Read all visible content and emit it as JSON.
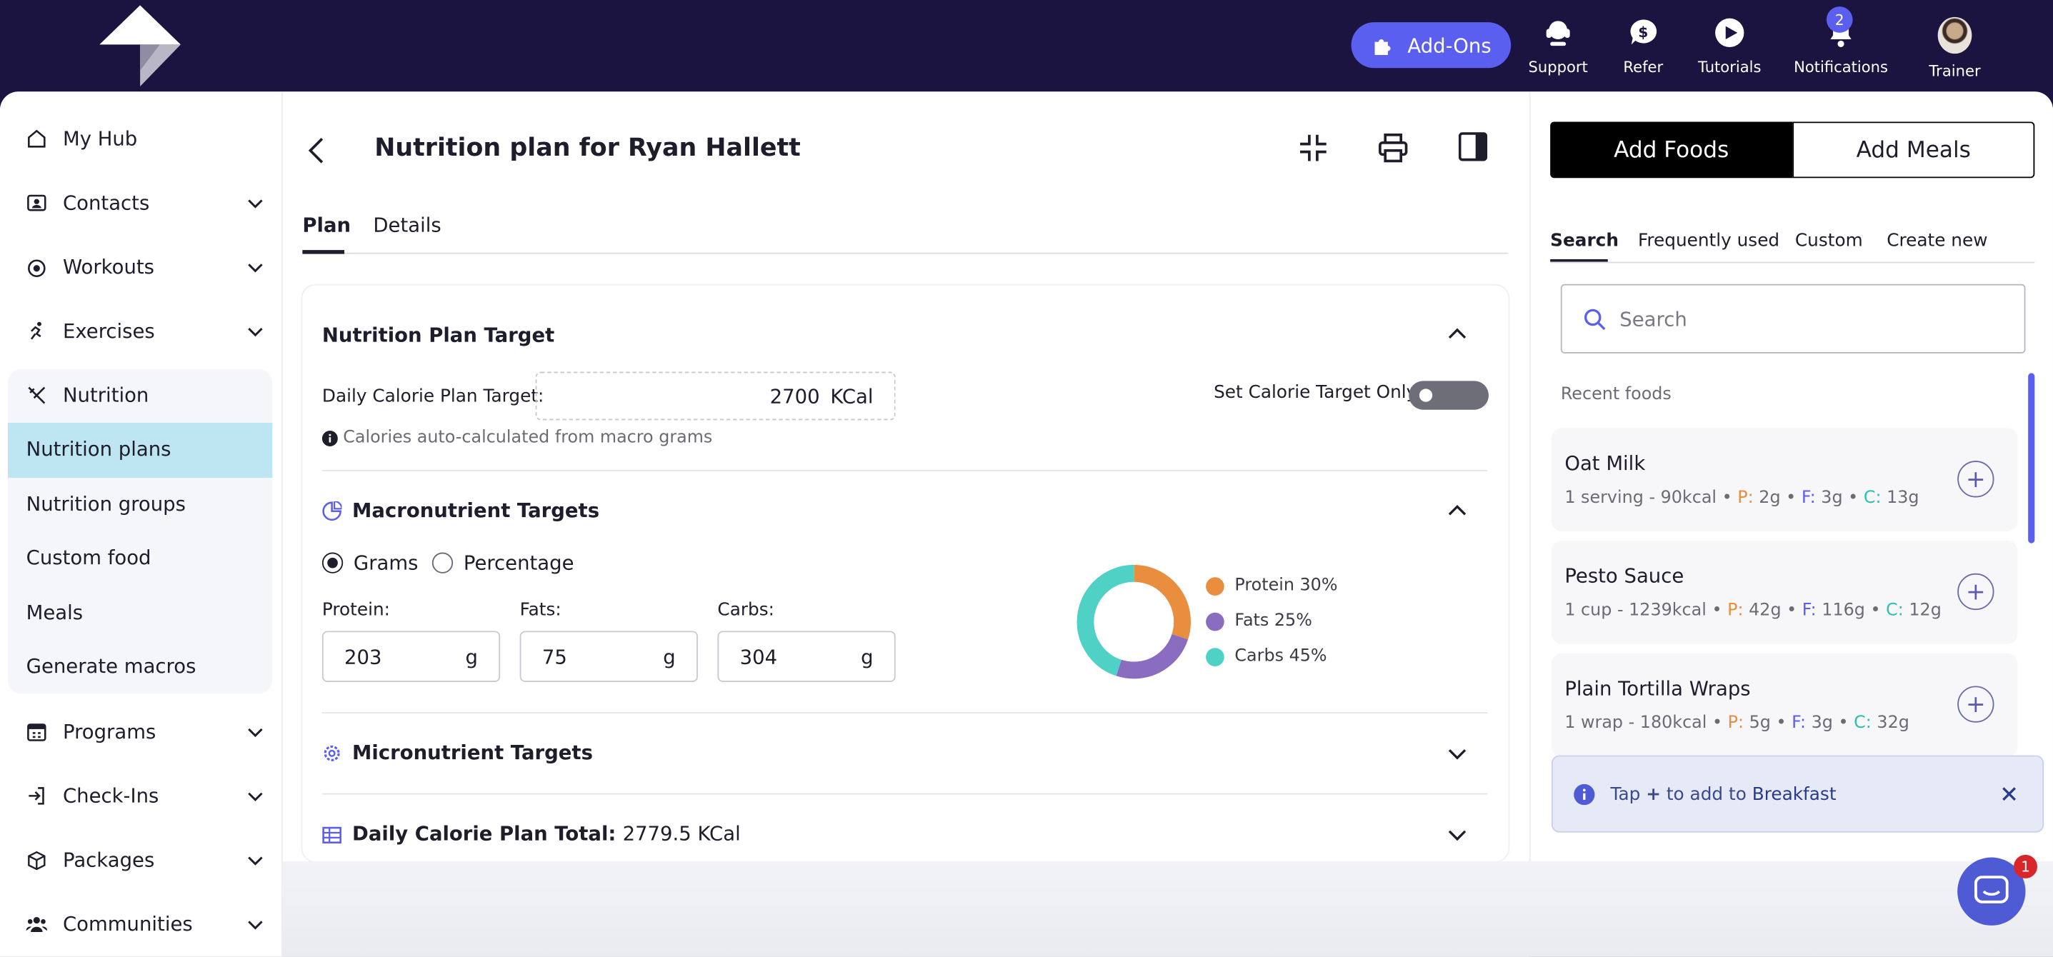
{
  "topbar": {
    "addons_label": "Add-Ons",
    "nav": [
      {
        "label": "Support",
        "icon": "headset-icon"
      },
      {
        "label": "Refer",
        "icon": "dollar-chat-icon"
      },
      {
        "label": "Tutorials",
        "icon": "play-icon"
      },
      {
        "label": "Notifications",
        "icon": "bell-icon",
        "badge": "2"
      },
      {
        "label": "Trainer",
        "icon": "avatar"
      }
    ]
  },
  "sidebar": {
    "items": [
      {
        "label": "My Hub",
        "icon": "home-icon"
      },
      {
        "label": "Contacts",
        "icon": "contacts-icon"
      },
      {
        "label": "Workouts",
        "icon": "workouts-icon"
      },
      {
        "label": "Exercises",
        "icon": "running-icon"
      },
      {
        "label": "Nutrition",
        "icon": "utensils-icon"
      },
      {
        "label": "Programs",
        "icon": "calendar-icon"
      },
      {
        "label": "Check-Ins",
        "icon": "check-in-icon"
      },
      {
        "label": "Packages",
        "icon": "package-icon"
      },
      {
        "label": "Communities",
        "icon": "users-icon"
      }
    ],
    "nutrition_sub": [
      "Nutrition plans",
      "Nutrition groups",
      "Custom food",
      "Meals",
      "Generate macros"
    ]
  },
  "plan": {
    "title": "Nutrition plan for Ryan Hallett",
    "tabs": [
      "Plan",
      "Details"
    ],
    "target_section": "Nutrition Plan Target",
    "daily_target_label": "Daily Calorie Plan Target:",
    "daily_target_value": "2700",
    "kcal_unit": "KCal",
    "calorie_only_label": "Set Calorie Target Only",
    "calorie_only_on": false,
    "auto_note": "Calories auto-calculated from macro grams",
    "macro_section": "Macronutrient Targets",
    "radio_grams": "Grams",
    "radio_percentage": "Percentage",
    "protein_label": "Protein:",
    "protein_value": "203",
    "fats_label": "Fats:",
    "fats_value": "75",
    "carbs_label": "Carbs:",
    "carbs_value": "304",
    "unit_g": "g",
    "micro_section": "Micronutrient Targets",
    "total_label": "Daily Calorie Plan Total:",
    "total_value": "2779.5 KCal"
  },
  "macros_chart": {
    "legend": [
      {
        "label": "Protein 30%",
        "value": 30,
        "color": "#e98e3e"
      },
      {
        "label": "Fats 25%",
        "value": 25,
        "color": "#8a6cc0"
      },
      {
        "label": "Carbs 45%",
        "value": 45,
        "color": "#4fd1c5"
      }
    ]
  },
  "panel": {
    "add_foods": "Add Foods",
    "add_meals": "Add Meals",
    "tabs": [
      "Search",
      "Frequently used",
      "Custom",
      "Create new"
    ],
    "search_placeholder": "Search",
    "recent_label": "Recent foods",
    "foods": [
      {
        "name": "Oat Milk",
        "serving": "1 serving - 90kcal",
        "p": "2g",
        "f": "3g",
        "c": "13g"
      },
      {
        "name": "Pesto Sauce",
        "serving": "1 cup - 1239kcal",
        "p": "42g",
        "f": "116g",
        "c": "12g"
      },
      {
        "name": "Plain Tortilla Wraps",
        "serving": "1 wrap - 180kcal",
        "p": "5g",
        "f": "3g",
        "c": "32g"
      }
    ],
    "toast_prefix": "Tap",
    "toast_plus": "+",
    "toast_mid": "to add to",
    "toast_meal": "Breakfast"
  },
  "chat_badge": "1",
  "colors": {
    "accent": "#5b5ff0",
    "dark": "#1b1440",
    "active_sub": "#bee6f2",
    "protein": "#e98e3e",
    "fats": "#8a6cc0",
    "carbs": "#4fd1c5"
  }
}
